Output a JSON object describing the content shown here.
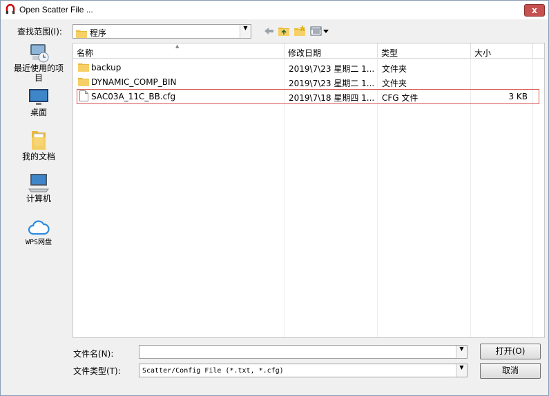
{
  "window": {
    "title": "Open Scatter File ...",
    "close_label": "x"
  },
  "look_in": {
    "label": "查找范围(I):",
    "value": "程序"
  },
  "places": [
    {
      "label_line1": "最近使用的项",
      "label_line2": "目",
      "icon": "recent-icon"
    },
    {
      "label_line1": "桌面",
      "label_line2": "",
      "icon": "desktop-icon"
    },
    {
      "label_line1": "我的文档",
      "label_line2": "",
      "icon": "documents-icon"
    },
    {
      "label_line1": "计算机",
      "label_line2": "",
      "icon": "computer-icon"
    },
    {
      "label_line1": "WPS网盘",
      "label_line2": "",
      "icon": "cloud-icon"
    }
  ],
  "columns": {
    "name": "名称",
    "date": "修改日期",
    "type": "类型",
    "size": "大小"
  },
  "files": [
    {
      "name": "backup",
      "date": "2019\\7\\23 星期二 1...",
      "type": "文件夹",
      "size": "",
      "icon": "folder-icon"
    },
    {
      "name": "DYNAMIC_COMP_BIN",
      "date": "2019\\7\\23 星期二 1...",
      "type": "文件夹",
      "size": "",
      "icon": "folder-icon"
    },
    {
      "name": "SAC03A_11C_BB.cfg",
      "date": "2019\\7\\18 星期四 1...",
      "type": "CFG 文件",
      "size": "3 KB",
      "icon": "file-icon"
    }
  ],
  "filename": {
    "label": "文件名(N):",
    "value": ""
  },
  "filetype": {
    "label": "文件类型(T):",
    "value": "Scatter/Config File (*.txt, *.cfg)"
  },
  "buttons": {
    "open": "打开(O)",
    "cancel": "取消"
  },
  "colors": {
    "selection_border": "#d9534f",
    "close_button": "#c75050"
  }
}
